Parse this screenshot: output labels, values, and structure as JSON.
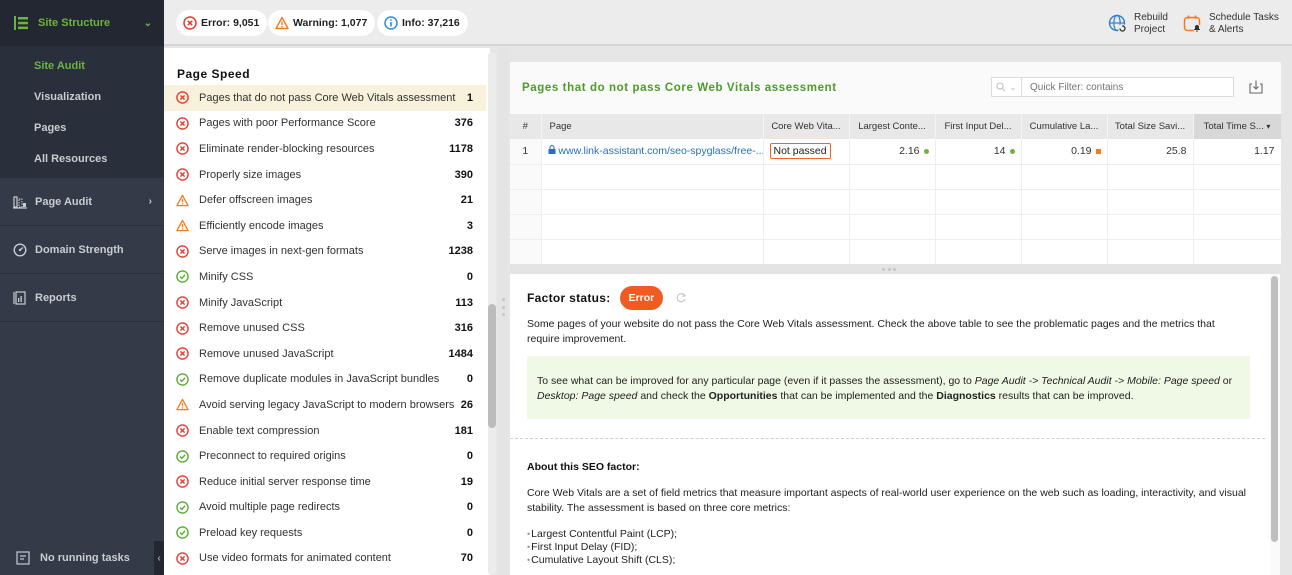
{
  "sidebar": {
    "section": {
      "label": "Site Structure",
      "icon": "site-structure-icon",
      "expanded": true
    },
    "sub_items": [
      {
        "label": "Site Audit",
        "active": true
      },
      {
        "label": "Visualization",
        "active": false
      },
      {
        "label": "Pages",
        "active": false
      },
      {
        "label": "All Resources",
        "active": false
      }
    ],
    "items": [
      {
        "label": "Page Audit",
        "icon": "page-audit-icon",
        "has_submenu": true
      },
      {
        "label": "Domain Strength",
        "icon": "gauge-icon",
        "has_submenu": false
      },
      {
        "label": "Reports",
        "icon": "reports-icon",
        "has_submenu": false
      }
    ],
    "footer": {
      "label": "No running tasks",
      "icon": "tasks-icon"
    },
    "collapse_glyph": "‹"
  },
  "topbar": {
    "summary": [
      {
        "type": "error",
        "label": "Error: 9,051",
        "color": "#e03c31"
      },
      {
        "type": "warning",
        "label": "Warning: 1,077",
        "color": "#f47a20"
      },
      {
        "type": "info",
        "label": "Info: 37,216",
        "color": "#2d8fdb"
      }
    ],
    "actions": [
      {
        "line1": "Rebuild",
        "line2": "Project",
        "icon": "rebuild-globe-icon"
      },
      {
        "line1": "Schedule Tasks",
        "line2": "& Alerts",
        "icon": "schedule-calendar-icon"
      }
    ]
  },
  "factor_list": {
    "title": "Page Speed",
    "items": [
      {
        "status": "error",
        "label": "Pages that do not pass Core Web Vitals assessment",
        "count": "1",
        "selected": true
      },
      {
        "status": "error",
        "label": "Pages with poor Performance Score",
        "count": "376"
      },
      {
        "status": "error",
        "label": "Eliminate render-blocking resources",
        "count": "1178"
      },
      {
        "status": "error",
        "label": "Properly size images",
        "count": "390"
      },
      {
        "status": "warning",
        "label": "Defer offscreen images",
        "count": "21"
      },
      {
        "status": "warning",
        "label": "Efficiently encode images",
        "count": "3"
      },
      {
        "status": "error",
        "label": "Serve images in next-gen formats",
        "count": "1238"
      },
      {
        "status": "ok",
        "label": "Minify CSS",
        "count": "0"
      },
      {
        "status": "error",
        "label": "Minify JavaScript",
        "count": "113"
      },
      {
        "status": "error",
        "label": "Remove unused CSS",
        "count": "316"
      },
      {
        "status": "error",
        "label": "Remove unused JavaScript",
        "count": "1484"
      },
      {
        "status": "ok",
        "label": "Remove duplicate modules in JavaScript bundles",
        "count": "0"
      },
      {
        "status": "warning",
        "label": "Avoid serving legacy JavaScript to modern browsers",
        "count": "26"
      },
      {
        "status": "error",
        "label": "Enable text compression",
        "count": "181"
      },
      {
        "status": "ok",
        "label": "Preconnect to required origins",
        "count": "0"
      },
      {
        "status": "error",
        "label": "Reduce initial server response time",
        "count": "19"
      },
      {
        "status": "ok",
        "label": "Avoid multiple page redirects",
        "count": "0"
      },
      {
        "status": "ok",
        "label": "Preload key requests",
        "count": "0"
      },
      {
        "status": "error",
        "label": "Use video formats for animated content",
        "count": "70"
      }
    ]
  },
  "table": {
    "title": "Pages that do not pass Core Web Vitals assessment",
    "quick_filter": {
      "placeholder": "Quick Filter: contains",
      "value": ""
    },
    "columns": [
      "#",
      "Page",
      "Core Web Vita...",
      "Largest Conte...",
      "First Input Del...",
      "Cumulative La...",
      "Total Size Savi...",
      "Total Time S..."
    ],
    "sorted_column": 7,
    "sort_glyph": "▾",
    "rows": [
      {
        "index": "1",
        "page": "www.link-assistant.com/seo-spyglass/free-...",
        "cwv": "Not passed",
        "lcp": "2.16",
        "lcp_indicator": "#6cb33f",
        "fid": "14",
        "fid_indicator": "#6cb33f",
        "cls": "0.19",
        "cls_indicator": "#f47a20",
        "size_savings": "25.8",
        "time_savings": "1.17"
      }
    ],
    "empty_rows": 4
  },
  "details": {
    "factor_status_label": "Factor status:",
    "factor_status_value": "Error",
    "description": "Some pages of your website do not pass the Core Web Vitals assessment. Check the above table to see the problematic pages and the metrics that require improvement.",
    "hint": {
      "t1": "To see what can be improved for any particular page (even if it passes the assessment), go to ",
      "i1": "Page Audit -> Technical Audit -> Mobile: Page speed",
      "t2": " or ",
      "i2": "Desktop: Page speed",
      "t3": " and check the ",
      "b1": "Opportunities",
      "t4": " that can be implemented and the ",
      "b2": "Diagnostics",
      "t5": " results that can be improved."
    },
    "about_title": "About this SEO factor:",
    "about_text": "Core Web Vitals are a set of field metrics that measure important aspects of real-world user experience on the web such as loading, interactivity, and visual stability. The assessment is based on three core metrics:",
    "metrics": [
      "Largest Contentful Paint (LCP);",
      "First Input Delay (FID);",
      "Cumulative Layout Shift (CLS);"
    ]
  }
}
